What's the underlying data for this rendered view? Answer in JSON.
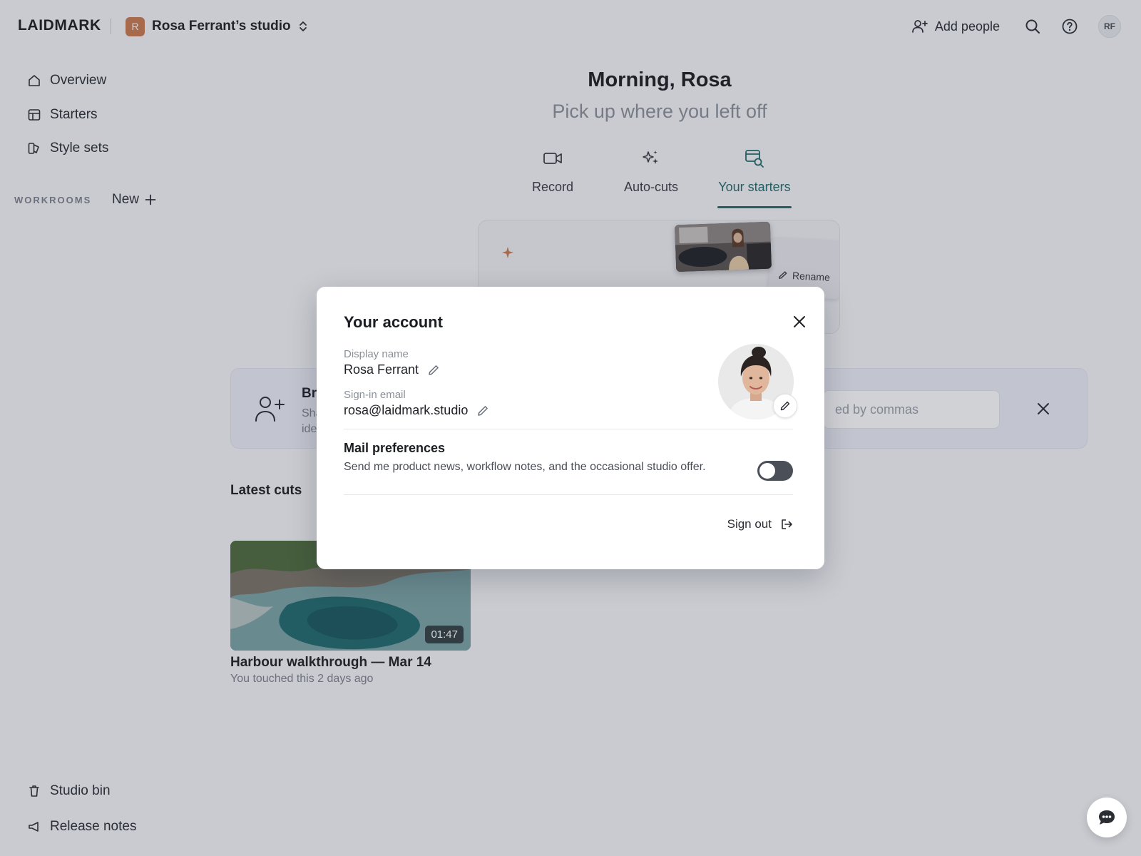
{
  "app": {
    "logo": "LAIDMARK",
    "studio": {
      "initial": "R",
      "name": "Rosa Ferrant’s studio",
      "initial_color": "#c97a4f"
    },
    "actions": {
      "add_people": "Add people",
      "user_initials": "RF"
    }
  },
  "sidebar": {
    "items": [
      {
        "label": "Overview",
        "icon": "home-icon"
      },
      {
        "label": "Starters",
        "icon": "layout-icon"
      },
      {
        "label": "Style sets",
        "icon": "swatch-icon"
      }
    ],
    "workrooms_label": "WORKROOMS",
    "new_label": "New",
    "bottom_items": [
      {
        "label": "Studio bin",
        "icon": "trash-icon"
      },
      {
        "label": "Release notes",
        "icon": "megaphone-icon"
      }
    ]
  },
  "main": {
    "greeting": "Morning, Rosa",
    "subtitle": "Pick up where you left off",
    "tabs": [
      {
        "label": "Record",
        "icon": "video-camera-icon",
        "active": false
      },
      {
        "label": "Auto-cuts",
        "icon": "sparkles-icon",
        "active": false
      },
      {
        "label": "Your starters",
        "icon": "template-search-icon",
        "active": true
      }
    ],
    "starter_card": {
      "rename_label": "Rename"
    },
    "invite_banner": {
      "title": "Br",
      "description": "Sha\nide",
      "input_placeholder": "ed by commas"
    },
    "latest": {
      "heading": "Latest cuts",
      "items": [
        {
          "title": "Harbour walkthrough — Mar 14",
          "meta": "You touched this 2 days ago",
          "duration": "01:47"
        }
      ]
    }
  },
  "modal": {
    "title": "Your account",
    "display_name_label": "Display name",
    "display_name": "Rosa Ferrant",
    "email_label": "Sign-in email",
    "email": "rosa@laidmark.studio",
    "mail_prefs_title": "Mail preferences",
    "mail_prefs_desc": "Send me product news, workflow notes, and the occasional studio offer.",
    "mail_prefs_enabled": false,
    "sign_out": "Sign out"
  },
  "colors": {
    "accent": "#1f6b6b",
    "toggle_off": "#4b4f58",
    "spark": "#c97a4f"
  }
}
